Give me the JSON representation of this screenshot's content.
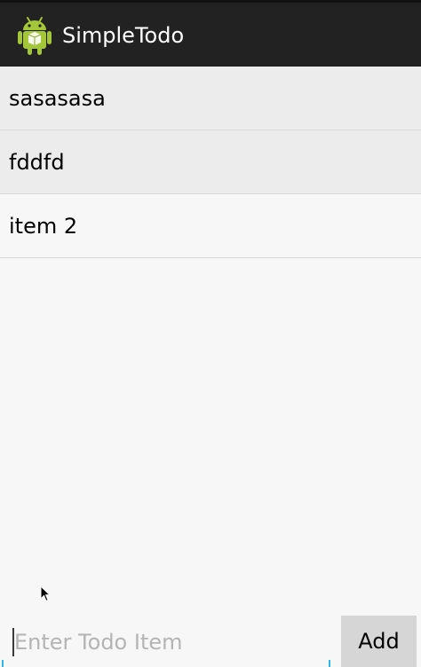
{
  "action_bar": {
    "title": "SimpleTodo",
    "icon": "android-icon",
    "background": "#222222"
  },
  "todo_list": {
    "items": [
      {
        "label": "sasasasa"
      },
      {
        "label": "fddfd"
      },
      {
        "label": "item 2"
      }
    ]
  },
  "new_item": {
    "placeholder": "Enter Todo Item",
    "value": "",
    "accent": "#33b5e5"
  },
  "add_button": {
    "label": "Add"
  }
}
